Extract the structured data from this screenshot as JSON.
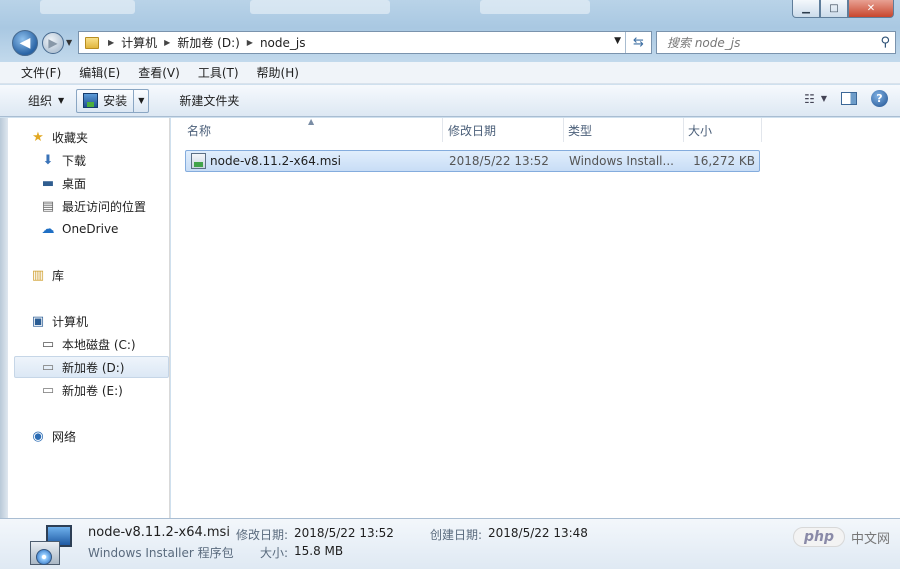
{
  "window": {
    "buttons": {
      "minimize": "▁",
      "maximize": "□",
      "close": "✕"
    }
  },
  "address": {
    "segments": [
      "计算机",
      "新加卷 (D:)",
      "node_js"
    ]
  },
  "search": {
    "placeholder": "搜索 node_js"
  },
  "menu": [
    "文件(F)",
    "编辑(E)",
    "查看(V)",
    "工具(T)",
    "帮助(H)"
  ],
  "toolbar": {
    "organize": "组织",
    "install": "安装",
    "new_folder": "新建文件夹"
  },
  "sidebar": {
    "favorites": "收藏夹",
    "downloads": "下载",
    "desktop": "桌面",
    "recent": "最近访问的位置",
    "onedrive": "OneDrive",
    "libraries": "库",
    "computer": "计算机",
    "drive_c": "本地磁盘 (C:)",
    "drive_d": "新加卷 (D:)",
    "drive_e": "新加卷 (E:)",
    "network": "网络"
  },
  "columns": {
    "name": "名称",
    "modified": "修改日期",
    "type": "类型",
    "size": "大小"
  },
  "files": [
    {
      "name": "node-v8.11.2-x64.msi",
      "modified": "2018/5/22 13:52",
      "type": "Windows Install...",
      "size": "16,272 KB"
    }
  ],
  "details": {
    "filename": "node-v8.11.2-x64.msi",
    "filetype": "Windows Installer 程序包",
    "modified_label": "修改日期:",
    "modified": "2018/5/22 13:52",
    "size_label": "大小:",
    "size": "15.8 MB",
    "created_label": "创建日期:",
    "created": "2018/5/22 13:48"
  },
  "watermark": {
    "logo": "php",
    "site": "中文网"
  }
}
